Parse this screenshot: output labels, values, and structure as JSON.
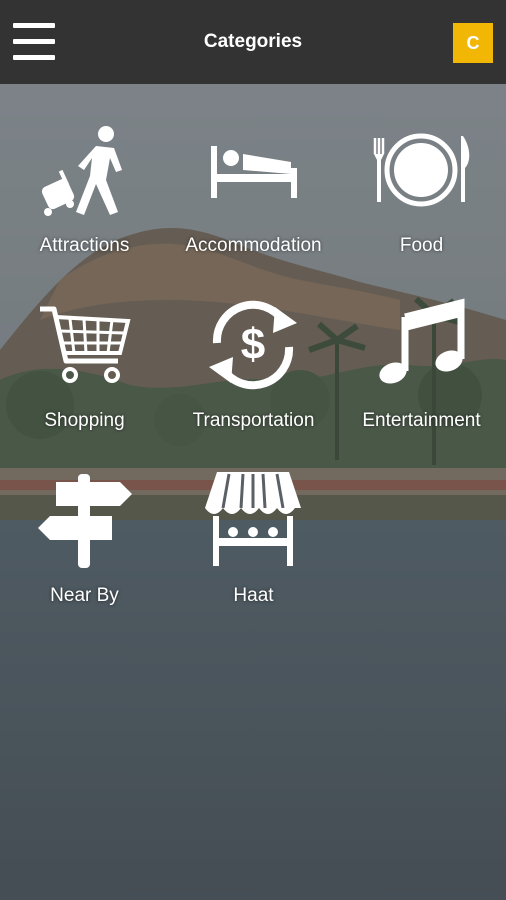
{
  "header": {
    "title": "Categories",
    "menu_icon": "hamburger-menu-icon",
    "action_button_label": "C",
    "accent_color": "#f2b705",
    "bar_color": "#333333"
  },
  "categories": [
    {
      "label": "Attractions",
      "icon": "traveler-icon"
    },
    {
      "label": "Accommodation",
      "icon": "bed-icon"
    },
    {
      "label": "Food",
      "icon": "plate-cutlery-icon"
    },
    {
      "label": "Shopping",
      "icon": "shopping-cart-icon"
    },
    {
      "label": "Transportation",
      "icon": "currency-exchange-icon"
    },
    {
      "label": "Entertainment",
      "icon": "music-note-icon"
    },
    {
      "label": "Near By",
      "icon": "signpost-icon"
    },
    {
      "label": "Haat",
      "icon": "market-stall-icon"
    }
  ]
}
